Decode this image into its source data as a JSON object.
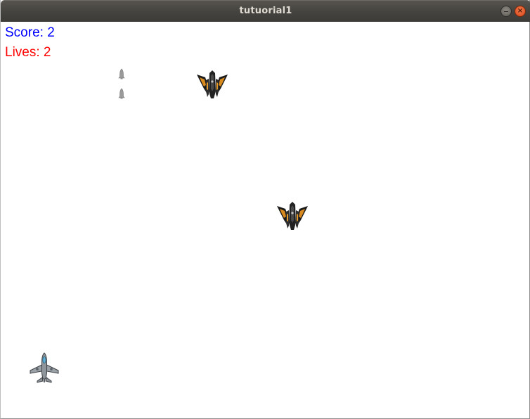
{
  "window": {
    "title": "tutuorial1",
    "controls": [
      "minimize-icon",
      "close-icon"
    ]
  },
  "hud": {
    "score_text": "Score: 2",
    "lives_text": "Lives: 2",
    "score_color": "#0000ff",
    "lives_color": "#ff0000"
  },
  "game": {
    "score": 2,
    "lives": 2,
    "entities": [
      {
        "type": "player-plane",
        "icon": "fighter-plane-icon",
        "count": 1
      },
      {
        "type": "enemy-ship",
        "icon": "enemy-ship-icon",
        "count": 2
      },
      {
        "type": "enemy-bullet",
        "icon": "bullet-icon",
        "count": 2
      }
    ],
    "background_color": "#ffffff"
  }
}
